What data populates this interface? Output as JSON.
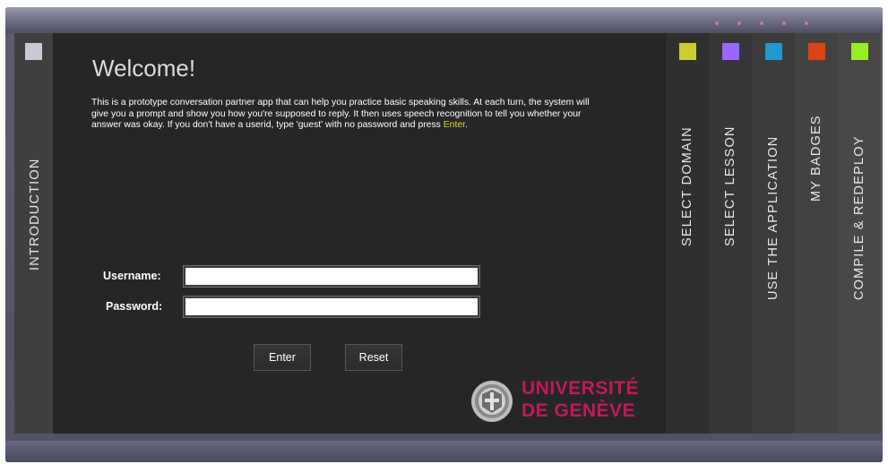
{
  "intro_tab": {
    "label": "INTRODUCTION",
    "swatch_color": "#c9c9d6"
  },
  "main": {
    "welcome": "Welcome!",
    "intro_text": "This is a prototype conversation partner app that can help you practice basic speaking skills. At each turn, the system will give you a prompt and show you how you're supposed to reply. It then uses speech recognition to tell you whether your answer was okay. If you don't have a userid, type 'guest' with no password and press ",
    "intro_highlight": "Enter",
    "intro_end": ".",
    "username_label": "Username:",
    "password_label": "Password:",
    "username_value": "",
    "password_value": "",
    "enter_button": "Enter",
    "reset_button": "Reset"
  },
  "logo": {
    "line1": "UNIVERSITÉ",
    "line2": "DE GENÈVE",
    "color": "#c2185b"
  },
  "right_tabs": [
    {
      "label": "SELECT DOMAIN",
      "swatch_color": "#cccc33"
    },
    {
      "label": "SELECT LESSON",
      "swatch_color": "#9966ff"
    },
    {
      "label": "USE THE APPLICATION",
      "swatch_color": "#2299cc"
    },
    {
      "label": "MY BADGES",
      "swatch_color": "#dd4411"
    },
    {
      "label": "COMPILE & REDEPLOY",
      "swatch_color": "#99ee22"
    }
  ]
}
